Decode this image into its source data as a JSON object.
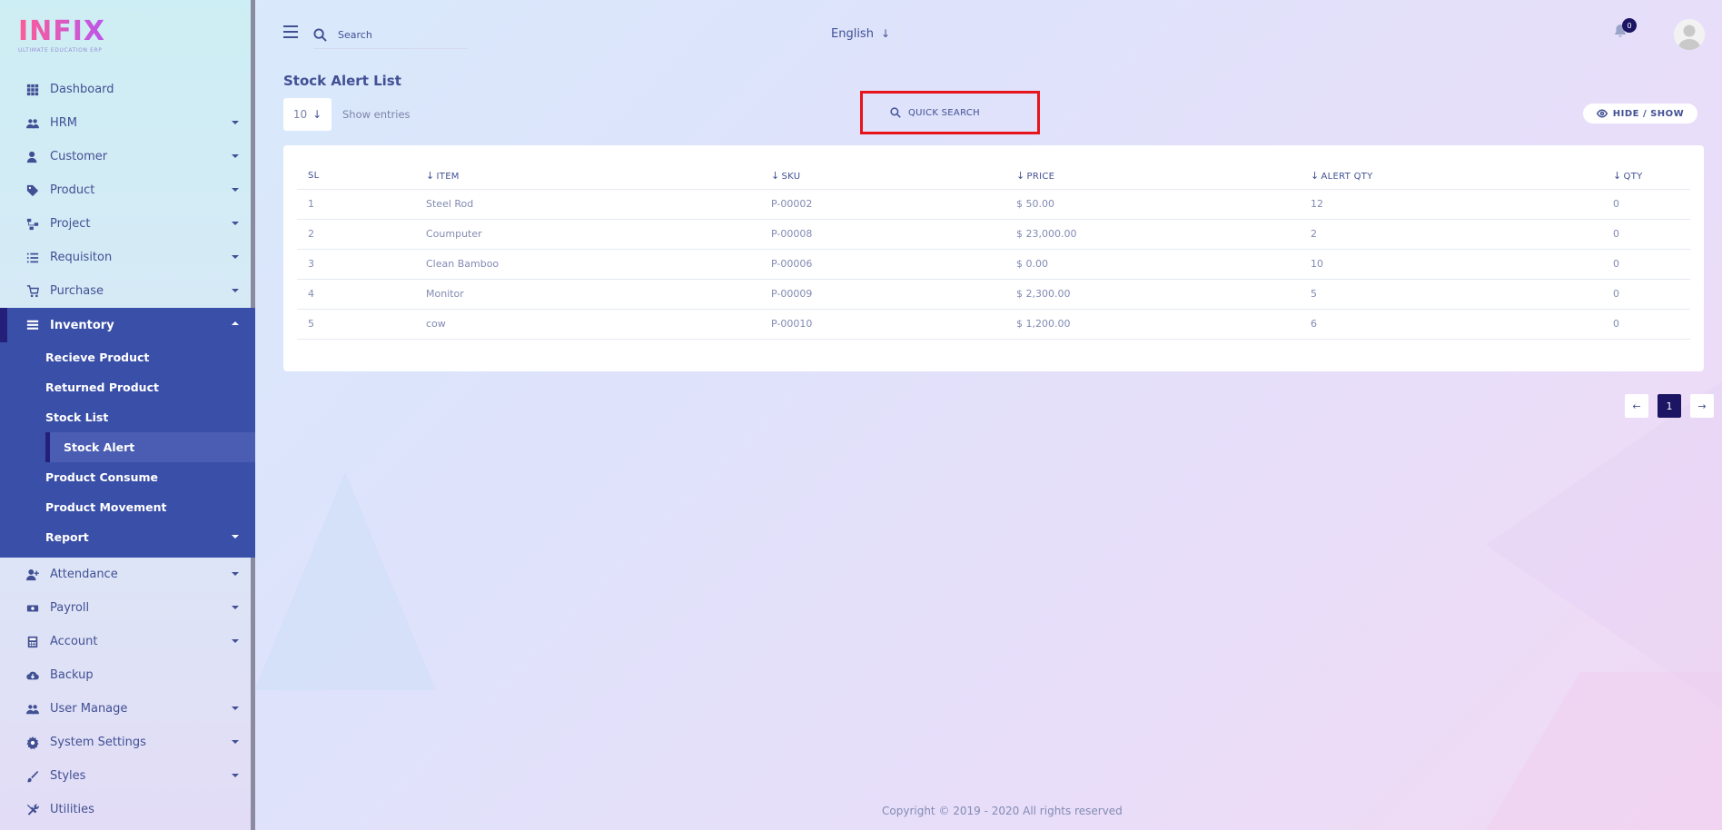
{
  "brand": {
    "logo_text": "INFIX",
    "logo_sub": "ULTIMATE EDUCATION ERP"
  },
  "sidebar": {
    "items": [
      {
        "label": "Dashboard",
        "icon": "dashboard-icon",
        "caret": false
      },
      {
        "label": "HRM",
        "icon": "users-icon",
        "caret": true
      },
      {
        "label": "Customer",
        "icon": "user-icon",
        "caret": true
      },
      {
        "label": "Product",
        "icon": "tags-icon",
        "caret": true
      },
      {
        "label": "Project",
        "icon": "project-icon",
        "caret": true
      },
      {
        "label": "Requisiton",
        "icon": "list-icon",
        "caret": true
      },
      {
        "label": "Purchase",
        "icon": "cart-icon",
        "caret": true
      },
      {
        "label": "Inventory",
        "icon": "inventory-icon",
        "caret": true,
        "active": true
      },
      {
        "label": "Attendance",
        "icon": "user-plus-icon",
        "caret": true
      },
      {
        "label": "Payroll",
        "icon": "money-icon",
        "caret": true
      },
      {
        "label": "Account",
        "icon": "calculator-icon",
        "caret": true
      },
      {
        "label": "Backup",
        "icon": "cloud-icon",
        "caret": false
      },
      {
        "label": "User Manage",
        "icon": "users-icon",
        "caret": true
      },
      {
        "label": "System Settings",
        "icon": "gear-icon",
        "caret": true
      },
      {
        "label": "Styles",
        "icon": "brush-icon",
        "caret": true
      },
      {
        "label": "Utilities",
        "icon": "tools-icon",
        "caret": false
      }
    ],
    "inventory_sub": [
      {
        "label": "Recieve Product"
      },
      {
        "label": "Returned Product"
      },
      {
        "label": "Stock List"
      },
      {
        "label": "Stock Alert",
        "current": true
      },
      {
        "label": "Product Consume"
      },
      {
        "label": "Product Movement"
      },
      {
        "label": "Report",
        "caret": true
      }
    ]
  },
  "header": {
    "search_placeholder": "Search",
    "language": "English",
    "notification_count": "0"
  },
  "main": {
    "title": "Stock Alert List",
    "entries_value": "10",
    "entries_label": "Show entries",
    "quick_search_placeholder": "QUICK SEARCH",
    "hide_show_label": "HIDE / SHOW",
    "table": {
      "columns": [
        "SL",
        "ITEM",
        "SKU",
        "PRICE",
        "ALERT QTY",
        "QTY"
      ],
      "rows": [
        [
          "1",
          "Steel Rod",
          "P-00002",
          "$ 50.00",
          "12",
          "0"
        ],
        [
          "2",
          "Coumputer",
          "P-00008",
          "$ 23,000.00",
          "2",
          "0"
        ],
        [
          "3",
          "Clean Bamboo",
          "P-00006",
          "$ 0.00",
          "10",
          "0"
        ],
        [
          "4",
          "Monitor",
          "P-00009",
          "$ 2,300.00",
          "5",
          "0"
        ],
        [
          "5",
          "cow",
          "P-00010",
          "$ 1,200.00",
          "6",
          "0"
        ]
      ]
    },
    "pagination": {
      "prev": "←",
      "current": "1",
      "next": "→"
    }
  },
  "footer": {
    "copyright": "Copyright © 2019 - 2020 All rights reserved"
  },
  "colors": {
    "primary": "#415094",
    "active_bg": "#3a4fa8",
    "accent_dark": "#1b1563",
    "highlight_red": "#e8141c"
  }
}
